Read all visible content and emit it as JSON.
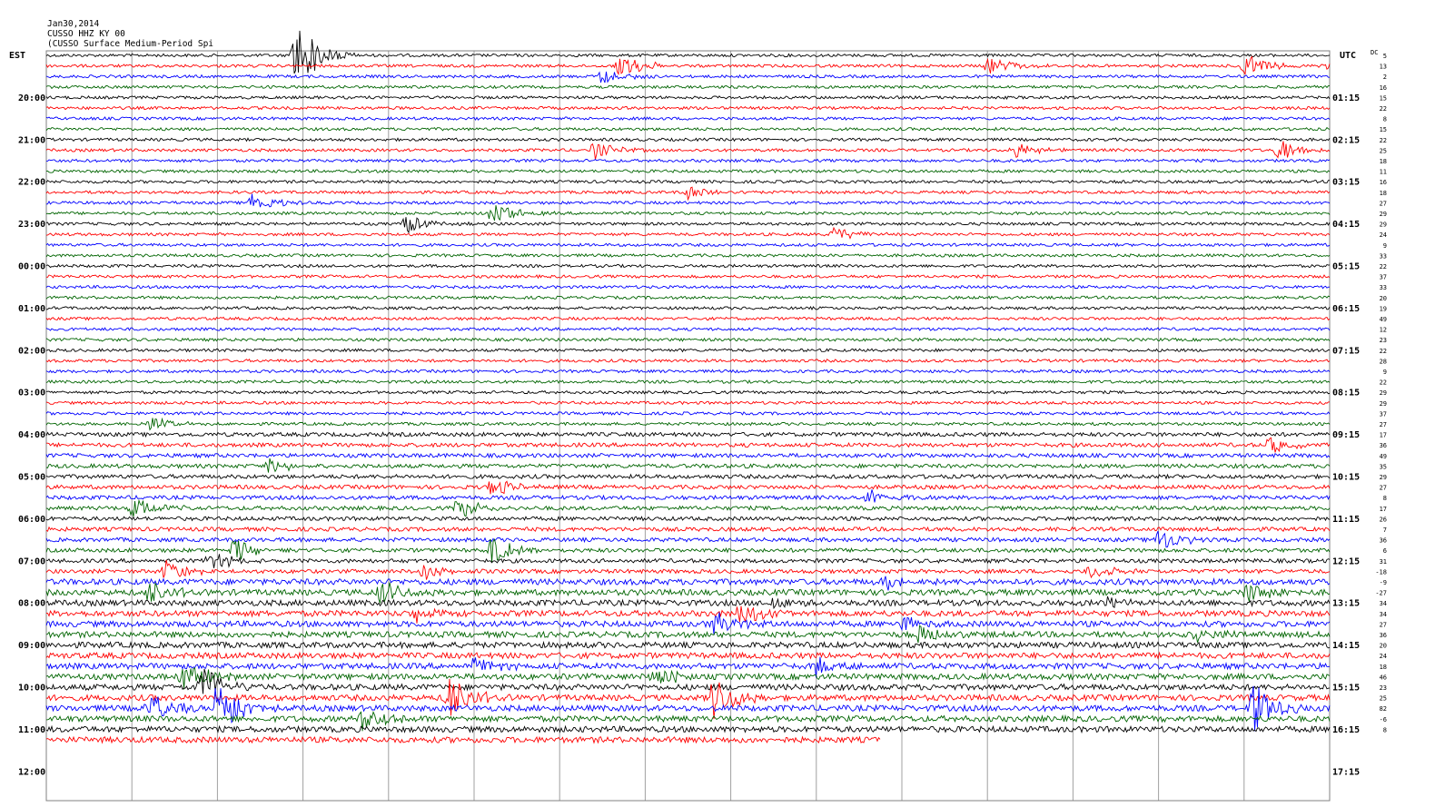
{
  "header": {
    "date": "Jan30,2014",
    "channel": "CUSSO HHZ KY 00",
    "description": "(CUSSO Surface Medium-Period Spi"
  },
  "axes": {
    "left_zone": "EST",
    "right_zone": "UTC",
    "dc_label": "DC"
  },
  "colors": {
    "trace_cycle": [
      "#000000",
      "#ff0000",
      "#0000ff",
      "#006400"
    ],
    "grid": "#a0a0a0",
    "text": "#000000"
  },
  "chart_data": {
    "type": "helicorder",
    "minutes_per_line": 15,
    "lines_total": 65,
    "lines_recorded": 66,
    "minutes_per_gridline": 3,
    "left_time_labels": [
      "20:00",
      "21:00",
      "22:00",
      "23:00",
      "00:00",
      "01:00",
      "02:00",
      "03:00",
      "04:00",
      "05:00",
      "06:00",
      "07:00",
      "08:00",
      "09:00",
      "10:00",
      "11:00",
      "12:00"
    ],
    "right_time_labels": [
      "01:15",
      "02:15",
      "03:15",
      "04:15",
      "05:15",
      "06:15",
      "07:15",
      "08:15",
      "09:15",
      "10:15",
      "11:15",
      "12:15",
      "13:15",
      "14:15",
      "15:15",
      "16:15",
      "17:15"
    ],
    "dc_offsets": [
      "5",
      "13",
      "2",
      "16",
      "15",
      "22",
      "8",
      "15",
      "22",
      "25",
      "18",
      "11",
      "16",
      "18",
      "27",
      "29",
      "29",
      "24",
      "9",
      "33",
      "22",
      "37",
      "33",
      "20",
      "19",
      "49",
      "12",
      "23",
      "22",
      "28",
      "9",
      "22",
      "29",
      "29",
      "37",
      "27",
      "17",
      "36",
      "49",
      "35",
      "29",
      "27",
      "8",
      "17",
      "26",
      "7",
      "36",
      "6",
      "31",
      "-18",
      "-9",
      "-27",
      "34",
      "34",
      "27",
      "36",
      "20",
      "24",
      "18",
      "46",
      "23",
      "25",
      "82",
      "-6",
      "8"
    ],
    "events": [
      {
        "line": 0,
        "minute": 2.9,
        "amp": 45
      },
      {
        "line": 1,
        "minute": 6.7,
        "amp": 16
      },
      {
        "line": 2,
        "minute": 6.5,
        "amp": 10
      },
      {
        "line": 1,
        "minute": 11.0,
        "amp": 12
      },
      {
        "line": 1,
        "minute": 14.0,
        "amp": 16
      },
      {
        "line": 1,
        "minute": 15.0,
        "amp": 10
      },
      {
        "line": 1,
        "minute": 19.2,
        "amp": 18
      },
      {
        "line": 2,
        "minute": 19.3,
        "amp": 8
      },
      {
        "line": 3,
        "minute": 17.1,
        "amp": 12
      },
      {
        "line": 6,
        "minute": 18.6,
        "amp": 8
      },
      {
        "line": 9,
        "minute": 6.4,
        "amp": 10
      },
      {
        "line": 9,
        "minute": 11.3,
        "amp": 10
      },
      {
        "line": 9,
        "minute": 14.4,
        "amp": 14
      },
      {
        "line": 9,
        "minute": 17.1,
        "amp": 14
      },
      {
        "line": 10,
        "minute": 17.1,
        "amp": 10
      },
      {
        "line": 11,
        "minute": 17.4,
        "amp": 8
      },
      {
        "line": 13,
        "minute": 7.5,
        "amp": 8
      },
      {
        "line": 14,
        "minute": 2.4,
        "amp": 12
      },
      {
        "line": 15,
        "minute": 5.2,
        "amp": 16
      },
      {
        "line": 16,
        "minute": 4.2,
        "amp": 12
      },
      {
        "line": 16,
        "minute": 16.8,
        "amp": 14
      },
      {
        "line": 17,
        "minute": 9.2,
        "amp": 10
      },
      {
        "line": 17,
        "minute": 16.9,
        "amp": 8
      },
      {
        "line": 35,
        "minute": 1.2,
        "amp": 8
      },
      {
        "line": 34,
        "minute": 16.6,
        "amp": 6
      },
      {
        "line": 37,
        "minute": 14.3,
        "amp": 10
      },
      {
        "line": 39,
        "minute": 2.6,
        "amp": 10
      },
      {
        "line": 41,
        "minute": 5.2,
        "amp": 12
      },
      {
        "line": 42,
        "minute": 9.6,
        "amp": 10
      },
      {
        "line": 43,
        "minute": 4.8,
        "amp": 14
      },
      {
        "line": 43,
        "minute": 1.0,
        "amp": 14
      },
      {
        "line": 45,
        "minute": 19.3,
        "amp": 12
      },
      {
        "line": 46,
        "minute": 13.0,
        "amp": 14
      },
      {
        "line": 47,
        "minute": 2.2,
        "amp": 14
      },
      {
        "line": 47,
        "minute": 5.2,
        "amp": 16
      },
      {
        "line": 48,
        "minute": 1.9,
        "amp": 12
      },
      {
        "line": 49,
        "minute": 1.4,
        "amp": 14
      },
      {
        "line": 49,
        "minute": 12.2,
        "amp": 10
      },
      {
        "line": 49,
        "minute": 4.4,
        "amp": 10
      },
      {
        "line": 50,
        "minute": 9.8,
        "amp": 12
      },
      {
        "line": 50,
        "minute": 17.2,
        "amp": 10
      },
      {
        "line": 51,
        "minute": 1.2,
        "amp": 14
      },
      {
        "line": 51,
        "minute": 3.9,
        "amp": 16
      },
      {
        "line": 51,
        "minute": 14.0,
        "amp": 14
      },
      {
        "line": 51,
        "minute": 17.8,
        "amp": 12
      },
      {
        "line": 52,
        "minute": 8.5,
        "amp": 8
      },
      {
        "line": 52,
        "minute": 12.4,
        "amp": 8
      },
      {
        "line": 52,
        "minute": 18.7,
        "amp": 14
      },
      {
        "line": 52,
        "minute": 20.7,
        "amp": 18
      },
      {
        "line": 53,
        "minute": 4.3,
        "amp": 12
      },
      {
        "line": 53,
        "minute": 8.1,
        "amp": 16
      },
      {
        "line": 54,
        "minute": 7.8,
        "amp": 14
      },
      {
        "line": 54,
        "minute": 10.0,
        "amp": 10
      },
      {
        "line": 55,
        "minute": 10.2,
        "amp": 12
      },
      {
        "line": 55,
        "minute": 13.4,
        "amp": 10
      },
      {
        "line": 56,
        "minute": 17.1,
        "amp": 14
      },
      {
        "line": 56,
        "minute": 20.8,
        "amp": 28
      },
      {
        "line": 57,
        "minute": 20.5,
        "amp": 26
      },
      {
        "line": 58,
        "minute": 17.1,
        "amp": 30
      },
      {
        "line": 58,
        "minute": 5.0,
        "amp": 10
      },
      {
        "line": 58,
        "minute": 9.0,
        "amp": 10
      },
      {
        "line": 59,
        "minute": 7.1,
        "amp": 12
      },
      {
        "line": 59,
        "minute": 1.6,
        "amp": 20
      },
      {
        "line": 59,
        "minute": 20.5,
        "amp": 16
      },
      {
        "line": 60,
        "minute": 1.8,
        "amp": 26
      },
      {
        "line": 60,
        "minute": 15.7,
        "amp": 20
      },
      {
        "line": 61,
        "minute": 4.7,
        "amp": 28
      },
      {
        "line": 61,
        "minute": 7.8,
        "amp": 26
      },
      {
        "line": 62,
        "minute": 2.0,
        "amp": 40
      },
      {
        "line": 62,
        "minute": 1.2,
        "amp": 18
      },
      {
        "line": 62,
        "minute": 14.1,
        "amp": 30
      },
      {
        "line": 63,
        "minute": 3.7,
        "amp": 18
      }
    ]
  }
}
